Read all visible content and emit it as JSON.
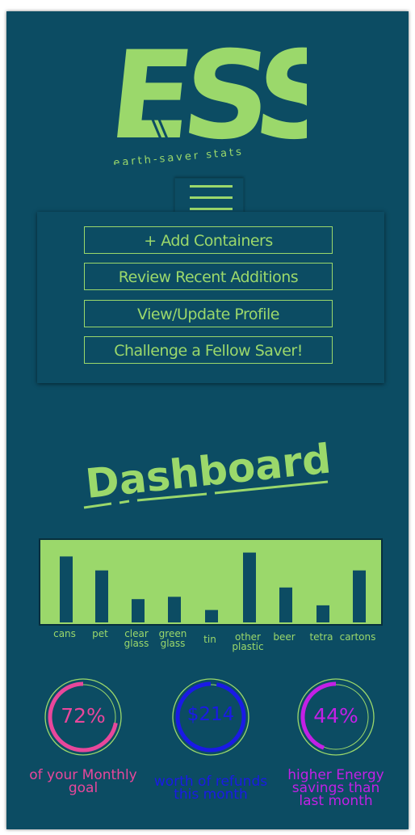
{
  "logo": {
    "letters": "ESS",
    "tagline": "earth-saver stats",
    "color": "#9bd86b"
  },
  "menu": {
    "items": [
      {
        "label": "+ Add Containers"
      },
      {
        "label": "Review Recent Additions"
      },
      {
        "label": "View/Update Profile"
      },
      {
        "label": "Challenge a Fellow Saver!"
      }
    ]
  },
  "dashboard": {
    "title": "Dashboard"
  },
  "chart_data": {
    "type": "bar",
    "categories": [
      "cans",
      "pet",
      "clear glass",
      "green glass",
      "tin",
      "other plastic",
      "beer",
      "tetra",
      "cartons"
    ],
    "values": [
      85,
      67,
      30,
      33,
      16,
      90,
      45,
      22,
      67
    ],
    "ylim": [
      0,
      100
    ],
    "title": "",
    "xlabel": "",
    "ylabel": "",
    "bar_color": "#0c4c63",
    "background": "#9bd86b"
  },
  "stats": [
    {
      "value": "72%",
      "caption": "of your Monthly goal",
      "fraction": 0.72,
      "color": "#e8479b"
    },
    {
      "value": "$214",
      "caption": "worth of refunds this month",
      "fraction": 0.97,
      "color": "#1a1ae6"
    },
    {
      "value": "44%",
      "caption": "higher Energy savings than last month",
      "fraction": 0.44,
      "color": "#c320e6"
    }
  ],
  "colors": {
    "background": "#0c4c63",
    "accent": "#9bd86b"
  }
}
